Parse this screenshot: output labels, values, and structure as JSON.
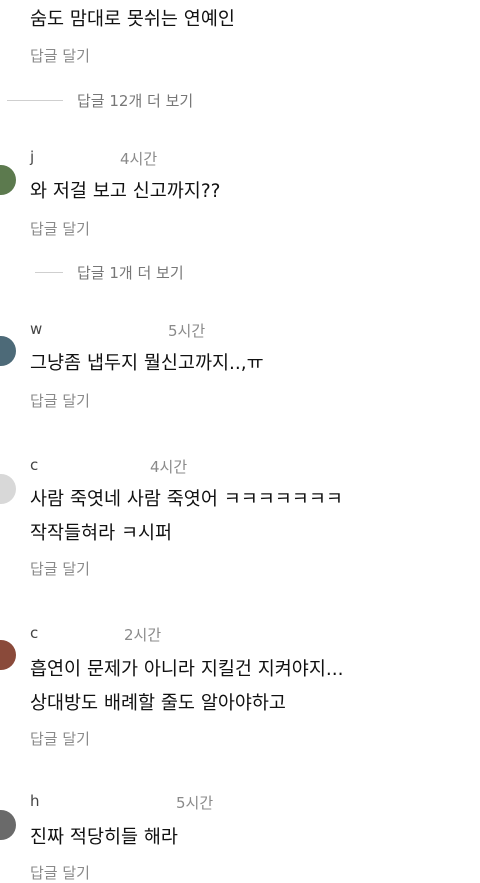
{
  "comments": [
    {
      "text_lines": [
        "숨도 맘대로 못쉬는 연예인"
      ],
      "reply": "답글 달기"
    },
    {
      "username": "j",
      "time": "4시간",
      "text_lines": [
        "와 저걸 보고 신고까지??"
      ],
      "reply": "답글 달기"
    },
    {
      "username": "w",
      "time": "5시간",
      "text_lines": [
        "그냥좀 냅두지  뭘신고까지..,ㅠ"
      ],
      "reply": "답글 달기"
    },
    {
      "username": "c",
      "time": "4시간",
      "text_lines": [
        "사람 죽엿네 사람 죽엿어 ㅋㅋㅋㅋㅋㅋㅋ",
        "작작들혀라 ㅋ시퍼"
      ],
      "reply": "답글 달기"
    },
    {
      "username": "c",
      "time": "2시간",
      "text_lines": [
        "흡연이  문제가 아니라  지킬건 지켜야지...",
        "상대방도  배례할  줄도 알아야하고"
      ],
      "reply": "답글 달기"
    },
    {
      "username": "h",
      "time": "5시간",
      "text_lines": [
        "진짜 적당히들 해라"
      ],
      "reply": "답글 달기"
    }
  ],
  "more_replies": [
    "답글 12개 더 보기",
    "답글 1개 더 보기"
  ],
  "colors": {
    "avatar1": "#5c7a4e",
    "avatar2": "#4d6a78",
    "avatar3": "#8a4a3a",
    "avatar4": "#6a6a6a"
  }
}
